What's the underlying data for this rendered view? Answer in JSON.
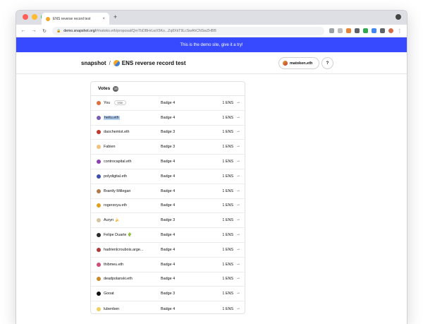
{
  "browser": {
    "tab_title": "ENS reverse record test",
    "tab_close": "×",
    "new_tab": "+",
    "url_host": "demo.snapshot.org/",
    "url_path": "#/natoko.eth/proposal/QmTbDBHrLwX5Ko...Zq8XkT9LcSwAhCNSwZHBB"
  },
  "banner": {
    "text": "This is the demo site, give it a try!"
  },
  "header": {
    "brand": "snapshot",
    "separator": "/",
    "space_name": "ENS reverse record test",
    "account": "matoken.eth",
    "help": "?"
  },
  "votes": {
    "title": "Votes",
    "count": "16",
    "you_label": "Vote",
    "rows": [
      {
        "voter": "You",
        "you": true,
        "choice": "Badge 4",
        "power": "1 ENS",
        "avatar_color": "#e0703a"
      },
      {
        "voter": "heitu.eth",
        "selected": true,
        "choice": "Badge 4",
        "power": "1 ENS",
        "avatar_color": "#7a5bb5"
      },
      {
        "voter": "daochemist.eth",
        "choice": "Badge 3",
        "power": "1 ENS",
        "avatar_color": "#c0392b"
      },
      {
        "voter": "Fabien",
        "choice": "Badge 3",
        "power": "1 ENS",
        "avatar_color": "#f0c27b"
      },
      {
        "voter": "controcapital.eth",
        "choice": "Badge 4",
        "power": "1 ENS",
        "avatar_color": "#8e3fb0"
      },
      {
        "voter": "polydigital.eth",
        "choice": "Badge 4",
        "power": "1 ENS",
        "avatar_color": "#3c4fb0"
      },
      {
        "voter": "Brantly Millegan",
        "choice": "Badge 4",
        "power": "1 ENS",
        "avatar_color": "#b07a4a"
      },
      {
        "voter": "rogerzoya.eth",
        "choice": "Badge 4",
        "power": "1 ENS",
        "avatar_color": "#e0a020"
      },
      {
        "voter": "Auryn 🍌",
        "choice": "Badge 3",
        "power": "1 ENS",
        "avatar_color": "#d8c3a0"
      },
      {
        "voter": "Felipe Duarte 🌵",
        "choice": "Badge 4",
        "power": "1 ENS",
        "avatar_color": "#2a2a2a"
      },
      {
        "voter": "hadrienlcroubois.arge...",
        "choice": "Badge 4",
        "power": "1 ENS",
        "avatar_color": "#b03a3a"
      },
      {
        "voter": "thibmeu.eth",
        "choice": "Badge 4",
        "power": "1 ENS",
        "avatar_color": "#d04a7a"
      },
      {
        "voter": "deadpolanski.eth",
        "choice": "Badge 4",
        "power": "1 ENS",
        "avatar_color": "#c98a2a"
      },
      {
        "voter": "Gooat",
        "choice": "Badge 3",
        "power": "1 ENS",
        "avatar_color": "#111111"
      },
      {
        "voter": "lubenben",
        "choice": "Badge 4",
        "power": "1 ENS",
        "avatar_color": "#f0d060"
      }
    ]
  },
  "colors": {
    "banner": "#384aff",
    "selection": "#b6d3f7"
  },
  "icons": {
    "receipt": "receipt-icon"
  }
}
